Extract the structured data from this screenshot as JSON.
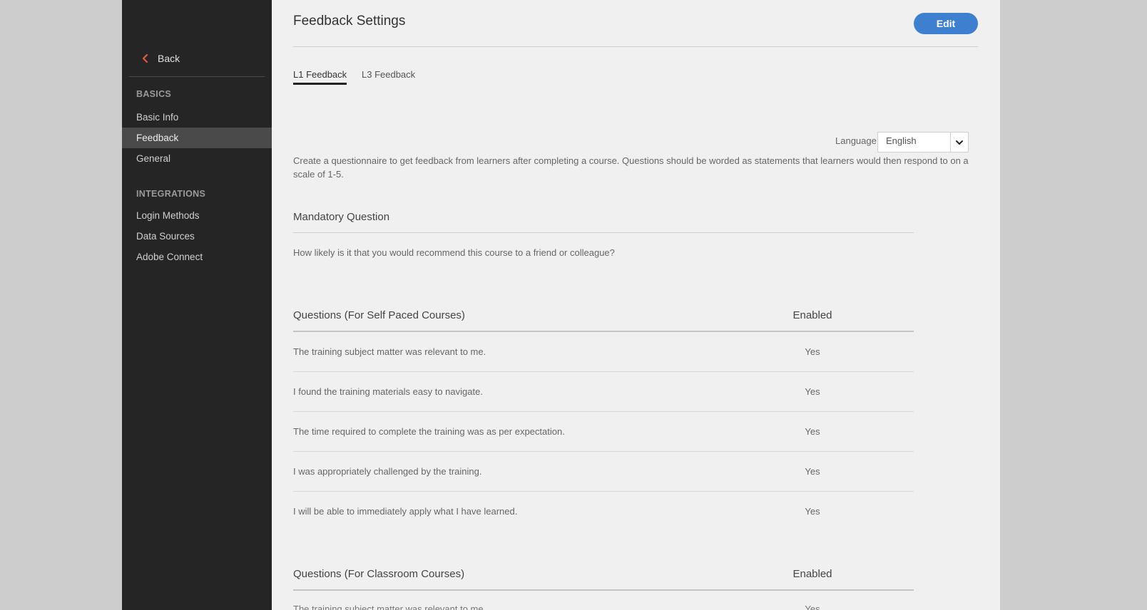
{
  "sidebar": {
    "back_label": "Back",
    "sections": [
      {
        "title": "BASICS",
        "items": [
          "Basic Info",
          "Feedback",
          "General"
        ]
      },
      {
        "title": "INTEGRATIONS",
        "items": [
          "Login Methods",
          "Data Sources",
          "Adobe Connect"
        ]
      }
    ],
    "active_item": "Feedback"
  },
  "header": {
    "title": "Feedback Settings",
    "edit_label": "Edit"
  },
  "tabs": [
    {
      "label": "L1 Feedback",
      "active": true
    },
    {
      "label": "L3 Feedback",
      "active": false
    }
  ],
  "language": {
    "label": "Language",
    "selected": "English"
  },
  "description": "Create a questionnaire to get feedback from learners after completing a course. Questions should be worded as statements that learners would then respond to on a scale of 1-5.",
  "mandatory": {
    "heading": "Mandatory Question",
    "question": "How likely is it that you would recommend this course to a friend or colleague?"
  },
  "self_paced": {
    "heading": "Questions (For Self Paced Courses)",
    "enabled_heading": "Enabled",
    "rows": [
      {
        "question": "The training subject matter was relevant to me.",
        "enabled": "Yes"
      },
      {
        "question": "I found the training materials easy to navigate.",
        "enabled": "Yes"
      },
      {
        "question": "The time required to complete the training was as per expectation.",
        "enabled": "Yes"
      },
      {
        "question": "I was appropriately challenged by the training.",
        "enabled": "Yes"
      },
      {
        "question": "I will be able to immediately apply what I have learned.",
        "enabled": "Yes"
      }
    ]
  },
  "classroom": {
    "heading": "Questions (For Classroom Courses)",
    "enabled_heading": "Enabled",
    "rows": [
      {
        "question": "The training subject matter was relevant to me.",
        "enabled": "Yes"
      }
    ]
  },
  "colors": {
    "accent": "#3f7fd0",
    "sidebar_bg": "#252525",
    "back_chevron": "#e05a47"
  }
}
